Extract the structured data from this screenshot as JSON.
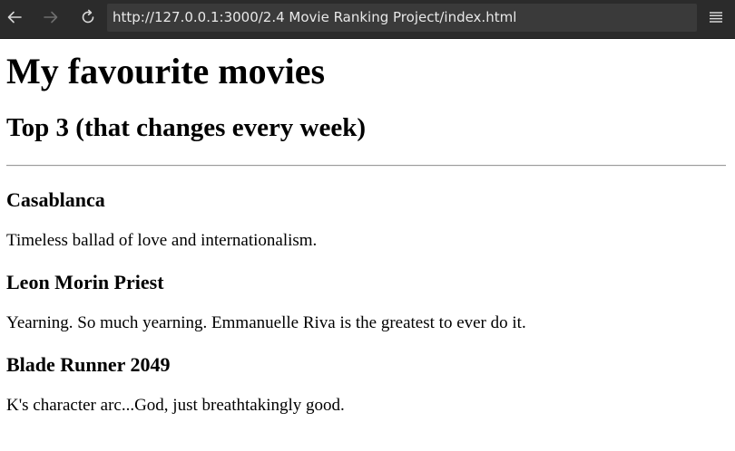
{
  "browser": {
    "url": "http://127.0.0.1:3000/2.4 Movie Ranking Project/index.html",
    "icons": {
      "back": "back-arrow-icon",
      "forward": "forward-arrow-icon",
      "reload": "reload-icon",
      "menu": "hamburger-menu-icon"
    }
  },
  "page": {
    "title": "My favourite movies",
    "subtitle": "Top 3 (that changes every week)",
    "movies": [
      {
        "title": "Casablanca",
        "description": "Timeless ballad of love and internationalism."
      },
      {
        "title": "Leon Morin Priest",
        "description": "Yearning. So much yearning. Emmanuelle Riva is the greatest to ever do it."
      },
      {
        "title": "Blade Runner 2049",
        "description": "K's character arc...God, just breathtakingly good."
      }
    ]
  },
  "colors": {
    "toolbar_bg": "#2b2b2b",
    "url_bar_bg": "#3a3a3a",
    "url_text": "#e8e8e8",
    "icon_active": "#d8d8d8",
    "icon_disabled": "#6e6e6e"
  }
}
